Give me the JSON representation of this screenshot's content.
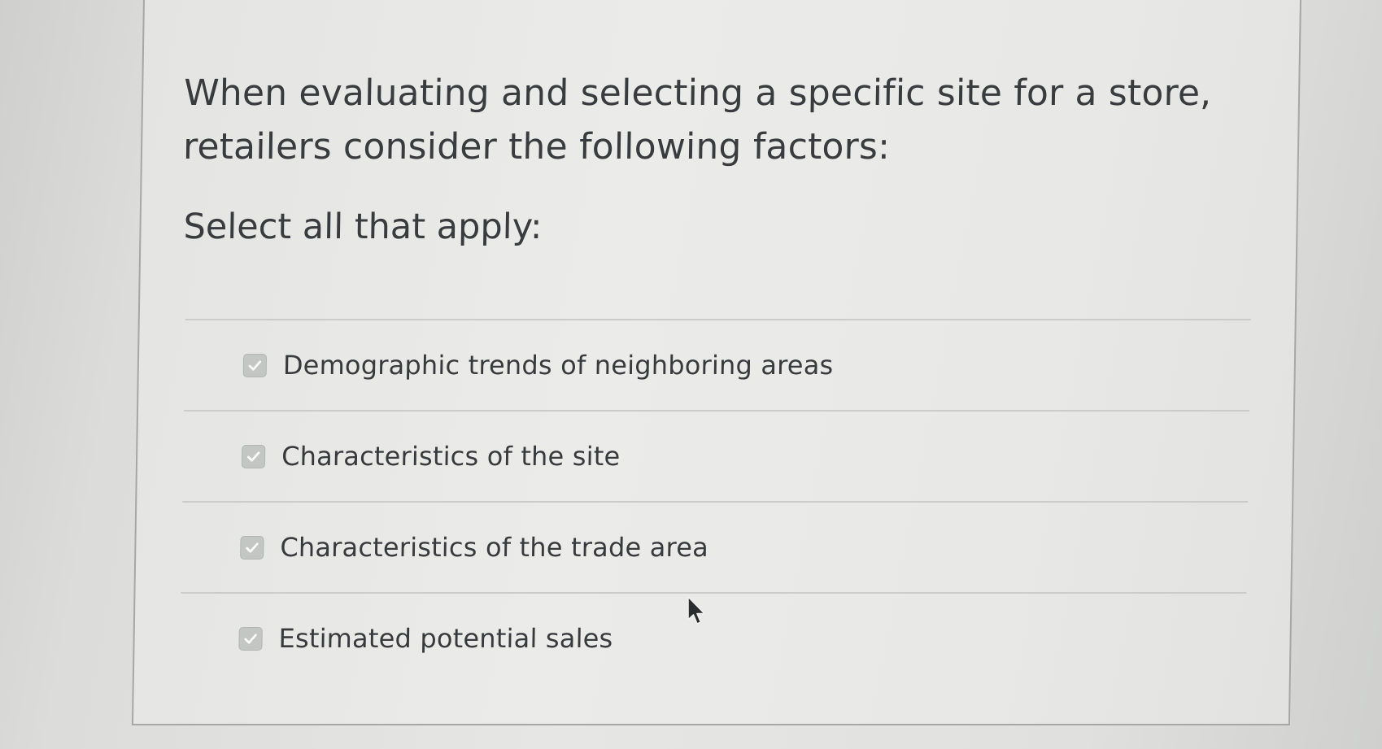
{
  "question": {
    "text": "When evaluating and selecting a specific site for a store, retailers consider the following factors:",
    "instruction": "Select all that apply:"
  },
  "options": [
    {
      "label": "Demographic trends of neighboring areas",
      "checked": true
    },
    {
      "label": "Characteristics of the site",
      "checked": true
    },
    {
      "label": "Characteristics of the trade area",
      "checked": true
    },
    {
      "label": "Estimated potential sales",
      "checked": true
    }
  ],
  "icons": {
    "checkbox": "checkmark-icon",
    "pointer": "mouse-cursor-icon"
  },
  "colors": {
    "text": "#3a3b3e",
    "checkbox_fill": "#c4c6c4",
    "divider": "#cbcbc9"
  }
}
